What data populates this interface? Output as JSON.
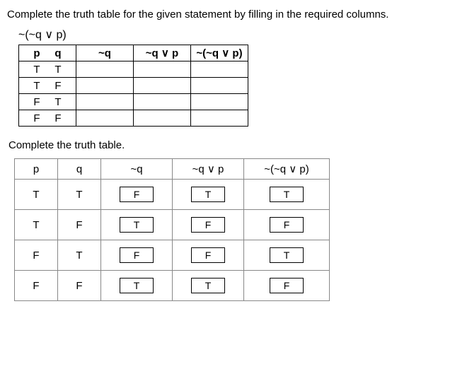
{
  "prompt": "Complete the truth table for the given statement by filling in the required columns.",
  "expression": "~(~q ∨ p)",
  "table1": {
    "headers": {
      "p": "p",
      "q": "q",
      "nq": "~q",
      "nqvp": "~q ∨ p",
      "final": "~(~q ∨ p)"
    },
    "rows": [
      {
        "p": "T",
        "q": "T"
      },
      {
        "p": "T",
        "q": "F"
      },
      {
        "p": "F",
        "q": "T"
      },
      {
        "p": "F",
        "q": "F"
      }
    ]
  },
  "subprompt": "Complete the truth table.",
  "table2": {
    "headers": {
      "p": "p",
      "q": "q",
      "nq": "~q",
      "nqvp": "~q ∨ p",
      "final": "~(~q ∨ p)"
    },
    "rows": [
      {
        "p": "T",
        "q": "T",
        "nq": "F",
        "nqvp": "T",
        "final": "T"
      },
      {
        "p": "T",
        "q": "F",
        "nq": "T",
        "nqvp": "F",
        "final": "F"
      },
      {
        "p": "F",
        "q": "T",
        "nq": "F",
        "nqvp": "F",
        "final": "T"
      },
      {
        "p": "F",
        "q": "F",
        "nq": "T",
        "nqvp": "T",
        "final": "F"
      }
    ]
  }
}
